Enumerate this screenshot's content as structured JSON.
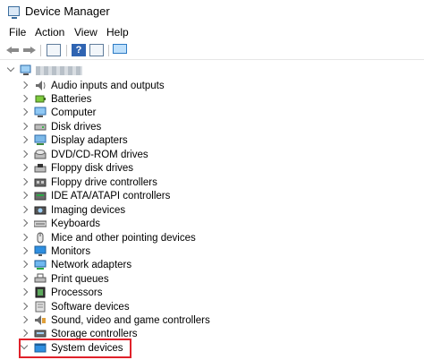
{
  "window": {
    "title": "Device Manager"
  },
  "menu": [
    "File",
    "Action",
    "View",
    "Help"
  ],
  "toolbar": {
    "buttons": [
      "back-icon",
      "forward-icon",
      "properties-window-icon",
      "help-icon",
      "update-driver-icon",
      "scan-monitor-icon"
    ]
  },
  "tree": {
    "root": {
      "label_visible": false,
      "expanded": true
    },
    "categories": [
      {
        "label": "Audio inputs and outputs",
        "icon": "speaker-icon"
      },
      {
        "label": "Batteries",
        "icon": "battery-icon"
      },
      {
        "label": "Computer",
        "icon": "computer-icon"
      },
      {
        "label": "Disk drives",
        "icon": "disk-drive-icon"
      },
      {
        "label": "Display adapters",
        "icon": "display-adapter-icon"
      },
      {
        "label": "DVD/CD-ROM drives",
        "icon": "dvd-icon"
      },
      {
        "label": "Floppy disk drives",
        "icon": "floppy-icon"
      },
      {
        "label": "Floppy drive controllers",
        "icon": "floppy-controller-icon"
      },
      {
        "label": "IDE ATA/ATAPI controllers",
        "icon": "ide-controller-icon"
      },
      {
        "label": "Imaging devices",
        "icon": "camera-icon"
      },
      {
        "label": "Keyboards",
        "icon": "keyboard-icon"
      },
      {
        "label": "Mice and other pointing devices",
        "icon": "mouse-icon"
      },
      {
        "label": "Monitors",
        "icon": "monitor-icon"
      },
      {
        "label": "Network adapters",
        "icon": "network-adapter-icon"
      },
      {
        "label": "Print queues",
        "icon": "printer-icon"
      },
      {
        "label": "Processors",
        "icon": "processor-icon"
      },
      {
        "label": "Software devices",
        "icon": "software-device-icon"
      },
      {
        "label": "Sound, video and game controllers",
        "icon": "sound-controller-icon"
      },
      {
        "label": "Storage controllers",
        "icon": "storage-controller-icon"
      },
      {
        "label": "System devices",
        "icon": "system-devices-icon",
        "expanded": true,
        "highlighted": true
      }
    ]
  },
  "colors": {
    "highlight_border": "#e0212a",
    "accent": "#2f64b2"
  }
}
